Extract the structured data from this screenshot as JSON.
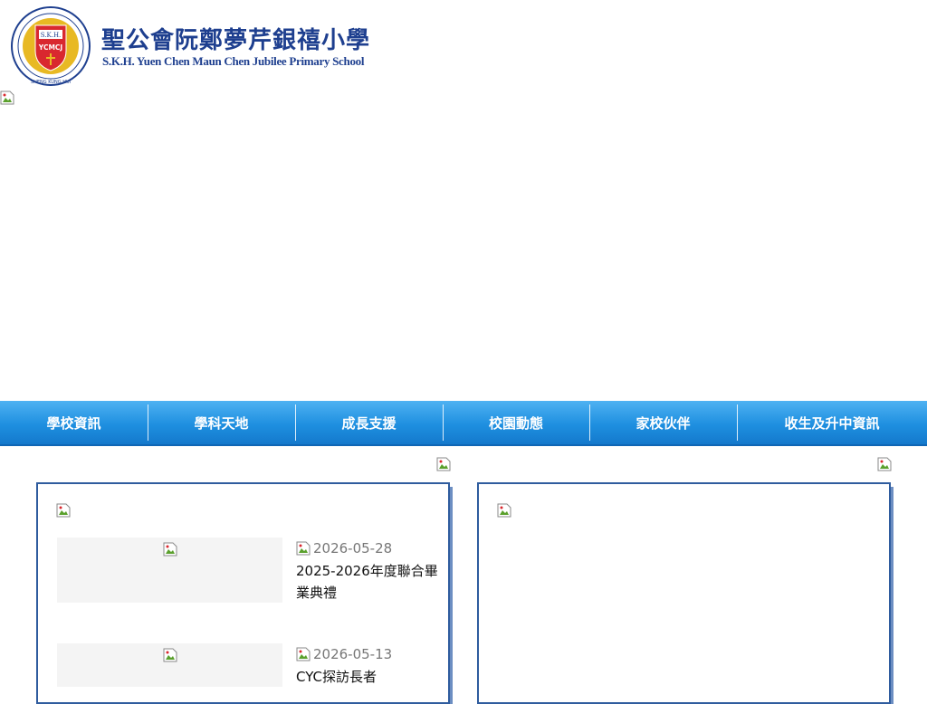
{
  "header": {
    "school_name_cn": "聖公會阮鄭夢芹銀禧小學",
    "school_name_en": "S.K.H. Yuen Chen Maun Chen Jubilee Primary School",
    "logo": {
      "center_text": "S.K.H.",
      "monogram": "YCMCJ",
      "ring_text": "SHENG KUNG HUI",
      "colors": {
        "ring": "#1e3f8f",
        "shield": "#d9282f",
        "gold": "#e8b923"
      }
    }
  },
  "nav": {
    "items": [
      {
        "label": "學校資訊"
      },
      {
        "label": "學科天地"
      },
      {
        "label": "成長支援"
      },
      {
        "label": "校園動態"
      },
      {
        "label": "家校伙伴"
      },
      {
        "label": "收生及升中資訊"
      }
    ],
    "colors": {
      "top": "#4fb2f2",
      "bottom": "#1479cc"
    }
  },
  "news": {
    "items": [
      {
        "date": "2026-05-28",
        "title": "2025-2026年度聯合畢業典禮"
      },
      {
        "date": "2026-05-13",
        "title": "CYC探訪長者"
      }
    ]
  },
  "colors": {
    "panel_border": "#2f5c9e",
    "brand_text": "#1e3f8f"
  }
}
